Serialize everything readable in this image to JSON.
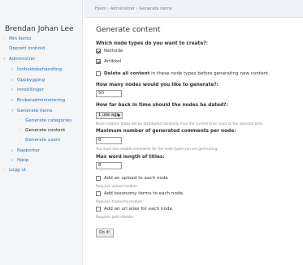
{
  "sidebar": {
    "user_name": "Brendan Johan Lee",
    "items": [
      {
        "label": "Min konto"
      },
      {
        "label": "Opprett innhold"
      },
      {
        "label": "Administrer"
      },
      {
        "label": "Innholdsbehandling"
      },
      {
        "label": "Oppbygging"
      },
      {
        "label": "Innstillinger"
      },
      {
        "label": "Brukeradministrering"
      },
      {
        "label": "Generate items"
      },
      {
        "label": "Generate categories"
      },
      {
        "label": "Generate content"
      },
      {
        "label": "Generate users"
      },
      {
        "label": "Rapporter"
      },
      {
        "label": "Hjelp"
      },
      {
        "label": "Logg ut"
      }
    ]
  },
  "breadcrumb": "Hjem › Administrer › Generate items",
  "page_title": "Generate content",
  "form": {
    "node_types_label": "Which node types do you want to create?:",
    "node_types": [
      {
        "label": "Nettside",
        "checked": true
      },
      {
        "label": "Artikkel",
        "checked": true
      }
    ],
    "delete_all_bold": "Delete all content",
    "delete_all_rest": " in these node types before generating new content.",
    "how_many_label": "How many nodes would you like to generate?:",
    "how_many_value": "50",
    "how_far_label": "How far back in time should the nodes be dated?:",
    "how_far_value": "1 uke ago",
    "how_far_desc": "Node creation dates will be distributed randomly from the current time, back to the selected time.",
    "max_comments_label": "Maximum number of generated comments per node:",
    "max_comments_value": "0",
    "max_comments_desc": "You must also enable comments for the node types you are generating.",
    "max_word_label": "Max word length of titles:",
    "max_word_value": "8",
    "upload_label": "Add an upload to each node",
    "upload_desc": "Requires upload.module",
    "taxonomy_label": "Add taxonomy terms to each node.",
    "taxonomy_desc": "Requires taxonomy.module",
    "alias_label": "Add an url alias for each node.",
    "alias_desc": "Requires path.module",
    "submit_label": "Do it!"
  }
}
